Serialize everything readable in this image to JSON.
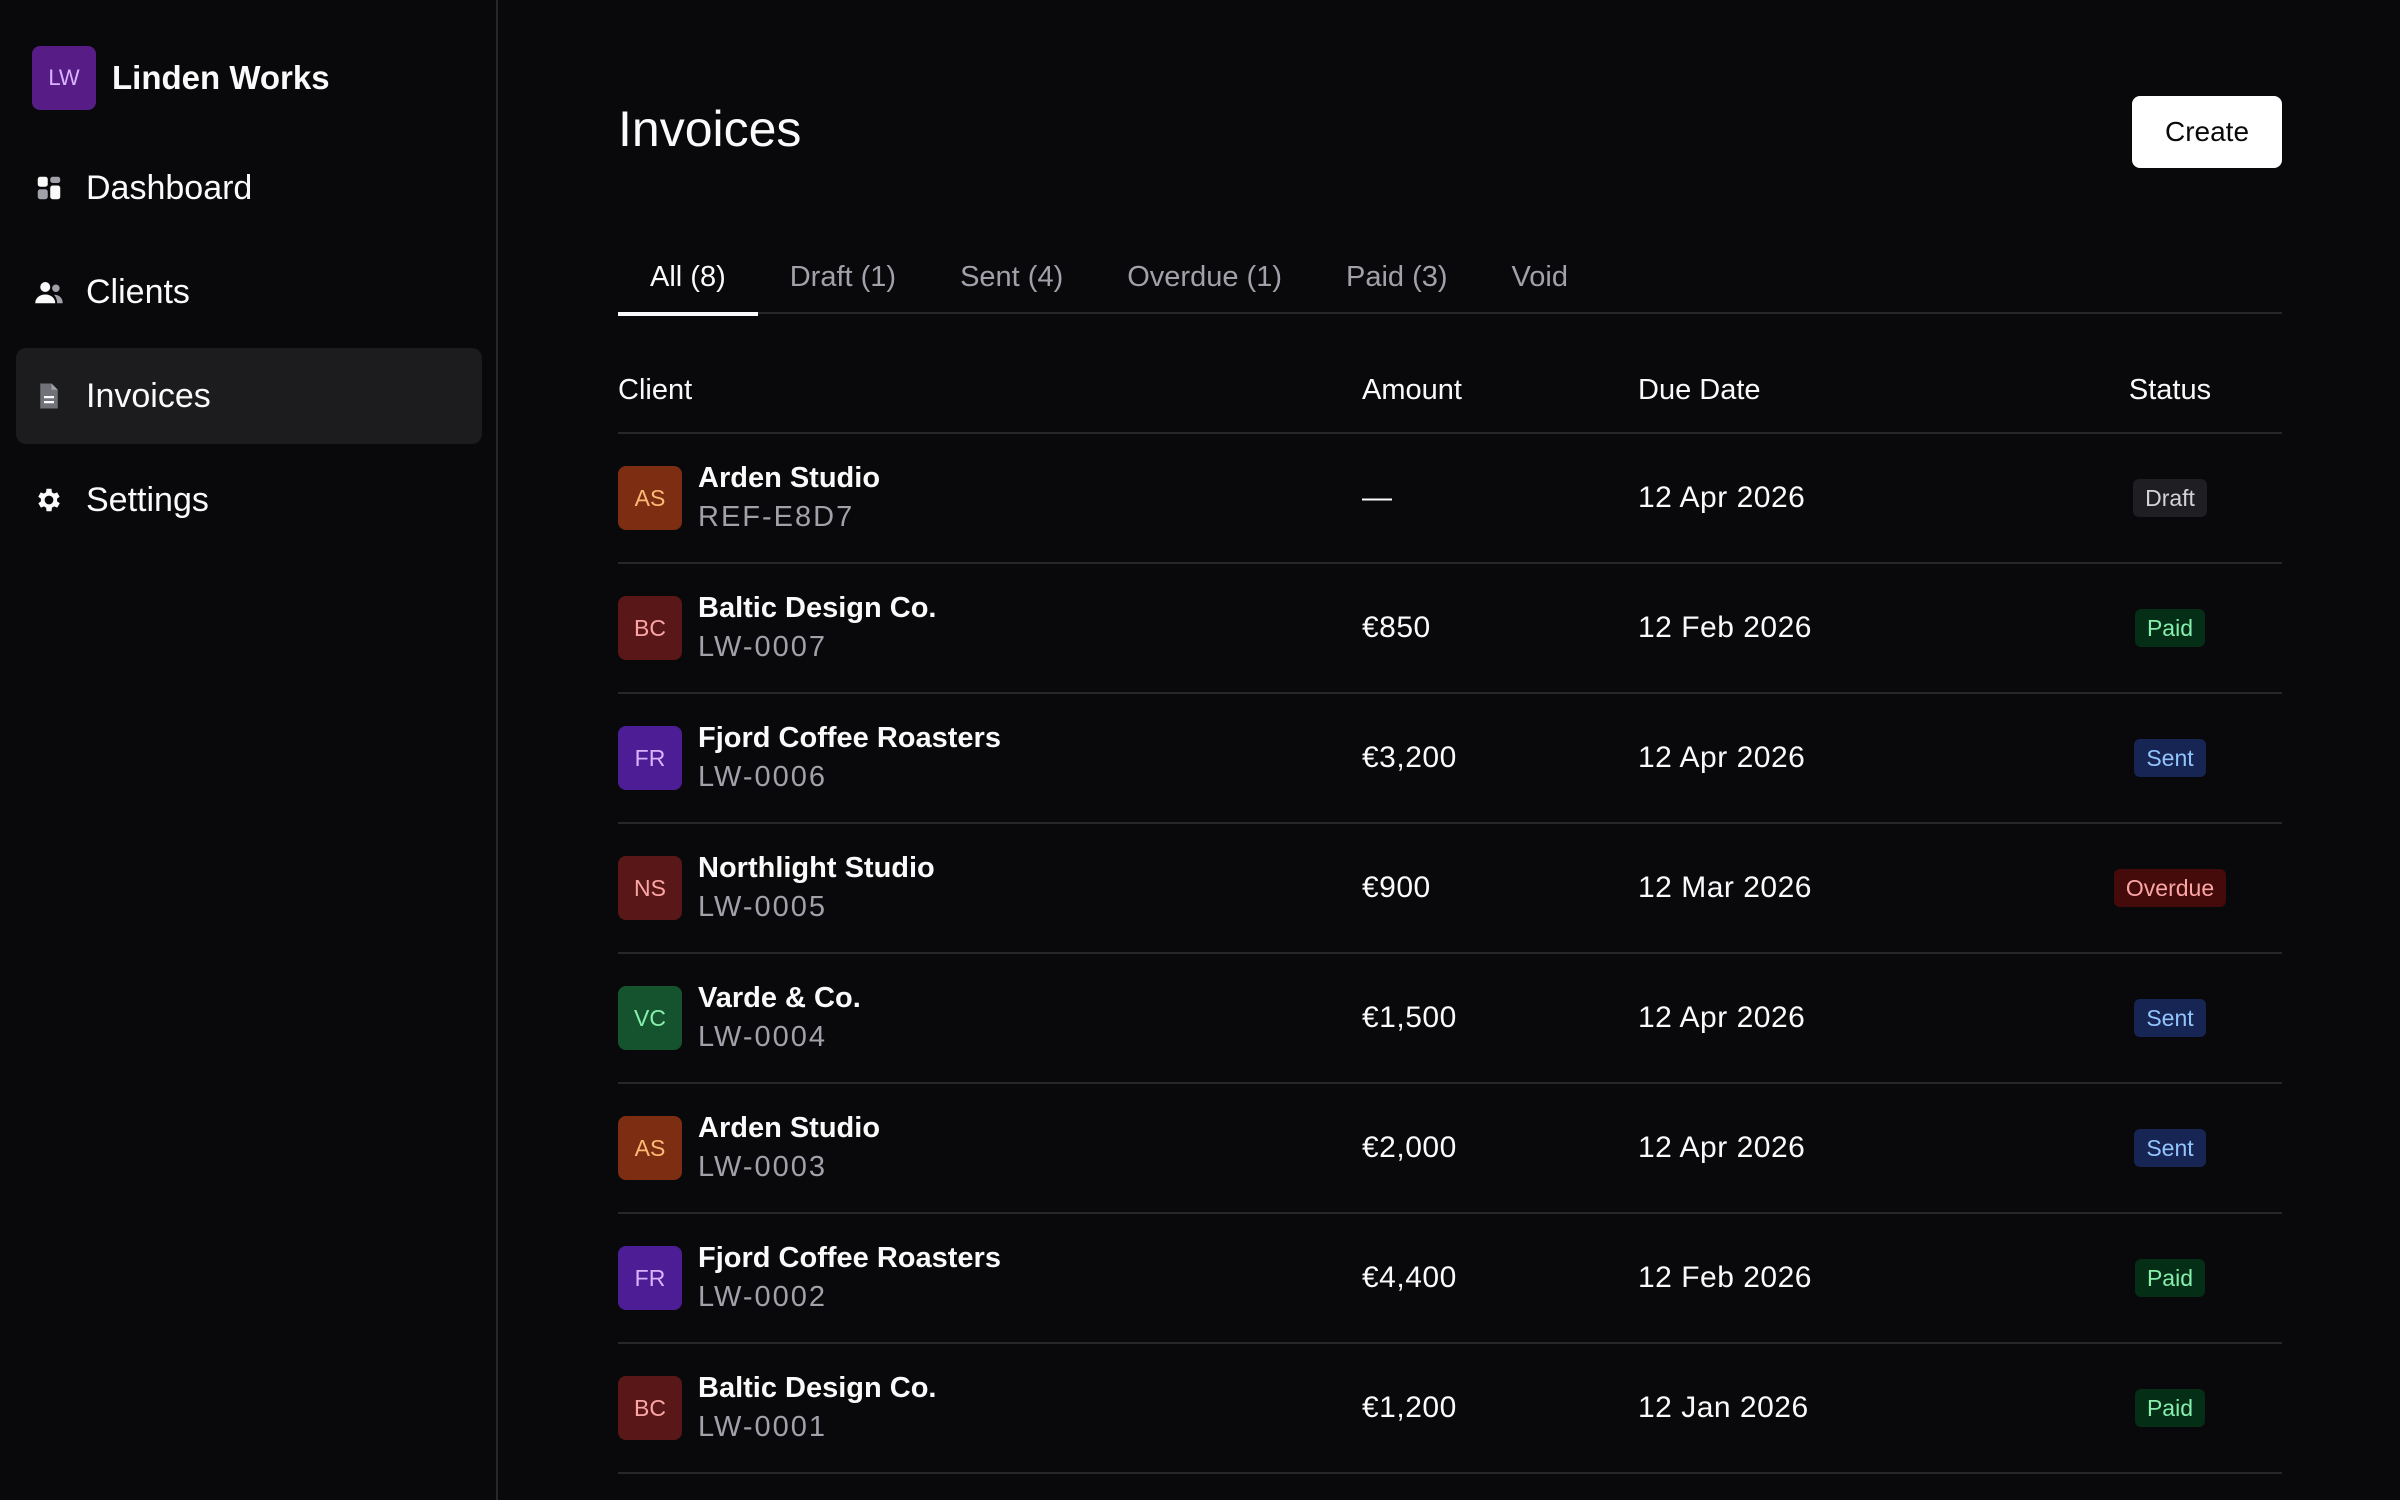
{
  "sidebar": {
    "brand": {
      "initials": "LW",
      "name": "Linden Works"
    },
    "items": [
      {
        "label": "Dashboard",
        "icon": "dashboard-icon",
        "active": false
      },
      {
        "label": "Clients",
        "icon": "users-icon",
        "active": false
      },
      {
        "label": "Invoices",
        "icon": "file-icon",
        "active": true
      },
      {
        "label": "Settings",
        "icon": "gear-icon",
        "active": false
      }
    ]
  },
  "main": {
    "title": "Invoices",
    "create_label": "Create",
    "tabs": [
      {
        "label": "All (8)",
        "active": true
      },
      {
        "label": "Draft (1)",
        "active": false
      },
      {
        "label": "Sent (4)",
        "active": false
      },
      {
        "label": "Overdue (1)",
        "active": false
      },
      {
        "label": "Paid (3)",
        "active": false
      },
      {
        "label": "Void",
        "active": false
      }
    ],
    "table": {
      "headers": {
        "client": "Client",
        "amount": "Amount",
        "due": "Due Date",
        "status": "Status"
      },
      "rows": [
        {
          "initials": "AS",
          "name": "Arden Studio",
          "ref": "REF-E8D7",
          "amount": "—",
          "due": "12 Apr 2026",
          "status": "Draft",
          "avatar_bg": "#7c2d12",
          "avatar_fg": "#fdba74"
        },
        {
          "initials": "BC",
          "name": "Baltic Design Co.",
          "ref": "LW-0007",
          "amount": "€850",
          "due": "12 Feb 2026",
          "status": "Paid",
          "avatar_bg": "#5a1717",
          "avatar_fg": "#fca5a5"
        },
        {
          "initials": "FR",
          "name": "Fjord Coffee Roasters",
          "ref": "LW-0006",
          "amount": "€3,200",
          "due": "12 Apr 2026",
          "status": "Sent",
          "avatar_bg": "#4c1d95",
          "avatar_fg": "#d8b4fe"
        },
        {
          "initials": "NS",
          "name": "Northlight Studio",
          "ref": "LW-0005",
          "amount": "€900",
          "due": "12 Mar 2026",
          "status": "Overdue",
          "avatar_bg": "#5a1717",
          "avatar_fg": "#fca5a5"
        },
        {
          "initials": "VC",
          "name": "Varde & Co.",
          "ref": "LW-0004",
          "amount": "€1,500",
          "due": "12 Apr 2026",
          "status": "Sent",
          "avatar_bg": "#14532d",
          "avatar_fg": "#86efac"
        },
        {
          "initials": "AS",
          "name": "Arden Studio",
          "ref": "LW-0003",
          "amount": "€2,000",
          "due": "12 Apr 2026",
          "status": "Sent",
          "avatar_bg": "#7c2d12",
          "avatar_fg": "#fdba74"
        },
        {
          "initials": "FR",
          "name": "Fjord Coffee Roasters",
          "ref": "LW-0002",
          "amount": "€4,400",
          "due": "12 Feb 2026",
          "status": "Paid",
          "avatar_bg": "#4c1d95",
          "avatar_fg": "#d8b4fe"
        },
        {
          "initials": "BC",
          "name": "Baltic Design Co.",
          "ref": "LW-0001",
          "amount": "€1,200",
          "due": "12 Jan 2026",
          "status": "Paid",
          "avatar_bg": "#5a1717",
          "avatar_fg": "#fca5a5"
        }
      ]
    }
  },
  "status_colors": {
    "Draft": {
      "bg": "#1f1f23",
      "fg": "#d4d4d8"
    },
    "Paid": {
      "bg": "#052e16",
      "fg": "#86efac"
    },
    "Sent": {
      "bg": "#172554",
      "fg": "#93c5fd"
    },
    "Overdue": {
      "bg": "#450a0a",
      "fg": "#fca5a5"
    }
  }
}
